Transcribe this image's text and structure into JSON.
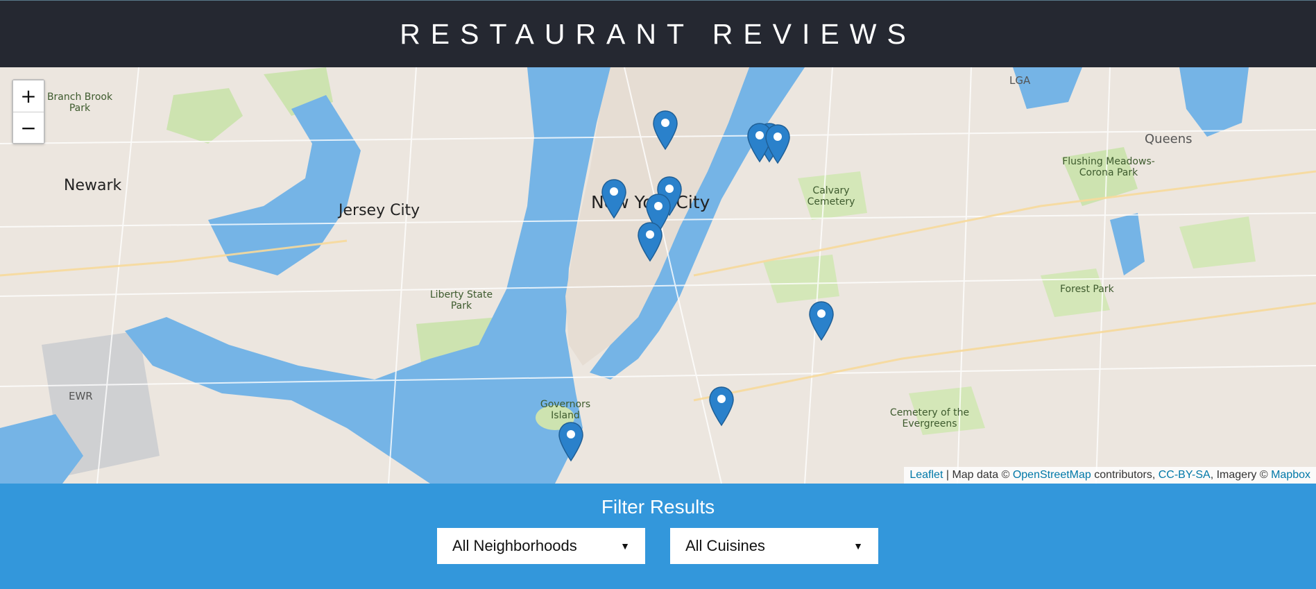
{
  "header": {
    "title": "RESTAURANT REVIEWS"
  },
  "map": {
    "zoom_in_label": "+",
    "zoom_out_label": "−",
    "labels": {
      "newark": "Newark",
      "jersey_city": "Jersey City",
      "new_york_city": "New York City",
      "queens": "Queens",
      "liberty_state_park": "Liberty State Park",
      "governors_island": "Governors Island",
      "calvary_cemetery": "Calvary Cemetery",
      "forest_park": "Forest Park",
      "flushing_meadows": "Flushing Meadows-Corona Park",
      "cemetery_evergreens": "Cemetery of the Evergreens",
      "branch_brook": "Branch Brook Park",
      "ewr": "EWR",
      "lga": "LGA"
    },
    "marker_count": 11,
    "attribution": {
      "leaflet": "Leaflet",
      "sep1": " | Map data © ",
      "osm": "OpenStreetMap",
      "contributors": " contributors, ",
      "license": "CC-BY-SA",
      "imagery": ", Imagery © ",
      "mapbox": "Mapbox"
    }
  },
  "filter": {
    "title": "Filter Results",
    "neighborhoods_selected": "All Neighborhoods",
    "cuisines_selected": "All Cuisines"
  },
  "colors": {
    "header_bg": "#252831",
    "filter_bg": "#3397db",
    "water": "#75b4e6",
    "marker": "#2a81cb"
  }
}
